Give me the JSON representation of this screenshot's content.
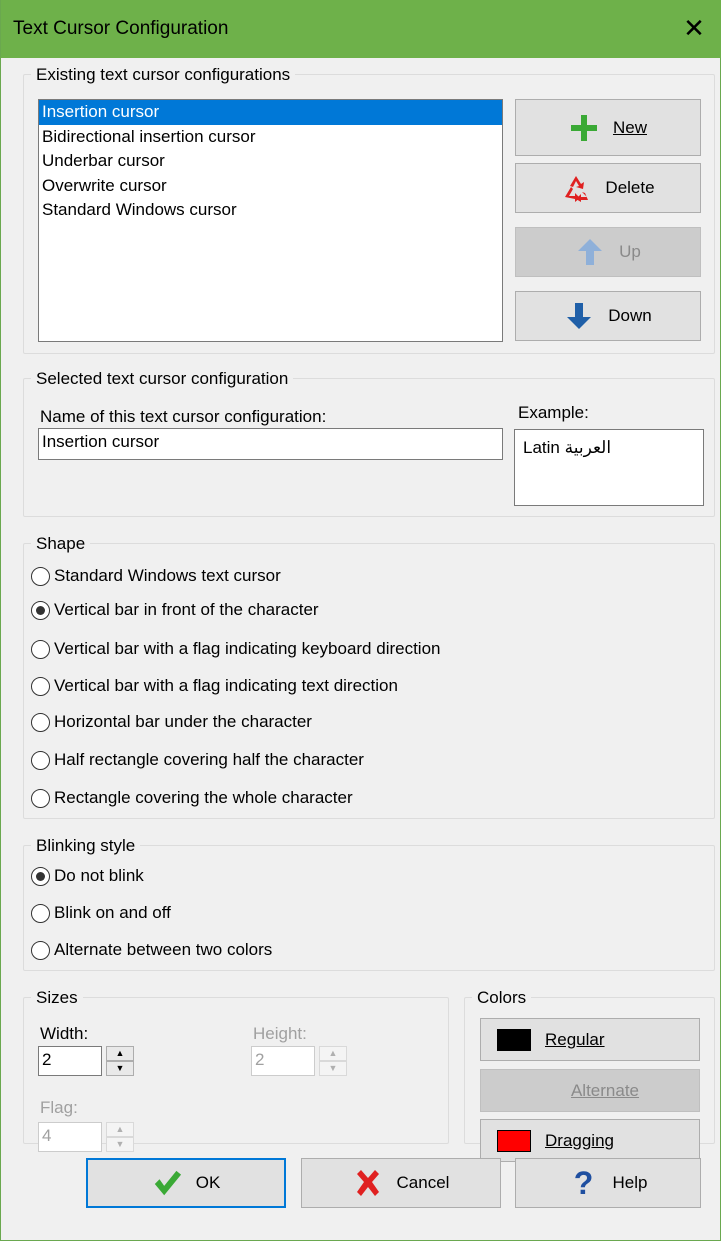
{
  "window": {
    "title": "Text Cursor Configuration",
    "close_glyph": "✕"
  },
  "existing": {
    "label": "Existing text cursor configurations",
    "items": [
      "Insertion cursor",
      "Bidirectional insertion cursor",
      "Underbar cursor",
      "Overwrite cursor",
      "Standard Windows cursor"
    ],
    "selected_index": 0,
    "buttons": {
      "new": "New",
      "delete": "Delete",
      "up": "Up",
      "down": "Down"
    }
  },
  "selected": {
    "label": "Selected text cursor configuration",
    "name_label": "Name of this text cursor configuration:",
    "name_value": "Insertion cursor",
    "example_label": "Example:",
    "example_latin": "Latin",
    "example_arabic": "العربية"
  },
  "shape": {
    "label": "Shape",
    "options": [
      "Standard Windows text cursor",
      "Vertical bar in front of the character",
      "Vertical bar with a flag indicating keyboard direction",
      "Vertical bar with a flag indicating text direction",
      "Horizontal bar under the character",
      "Half rectangle covering half the character",
      "Rectangle covering the whole character"
    ],
    "selected_index": 1
  },
  "blinking": {
    "label": "Blinking style",
    "options": [
      "Do not blink",
      "Blink on and off",
      "Alternate between two colors"
    ],
    "selected_index": 0
  },
  "sizes": {
    "label": "Sizes",
    "width_label": "Width:",
    "width_value": "2",
    "height_label": "Height:",
    "height_value": "2",
    "flag_label": "Flag:",
    "flag_value": "4"
  },
  "colors": {
    "label": "Colors",
    "regular": "Regular",
    "regular_color": "#000000",
    "alternate": "Alternate",
    "dragging": "Dragging",
    "dragging_color": "#ff0000"
  },
  "footer": {
    "ok": "OK",
    "cancel": "Cancel",
    "help": "Help"
  },
  "theme": {
    "titlebar": "#6eb14a",
    "selection": "#0078d7",
    "new_icon": "#3aa935",
    "delete_icon": "#e02020",
    "arrow_icon": "#1f5fa8",
    "cancel_icon": "#e02020",
    "ok_icon": "#3aa935",
    "help_icon": "#1f4fa0"
  }
}
